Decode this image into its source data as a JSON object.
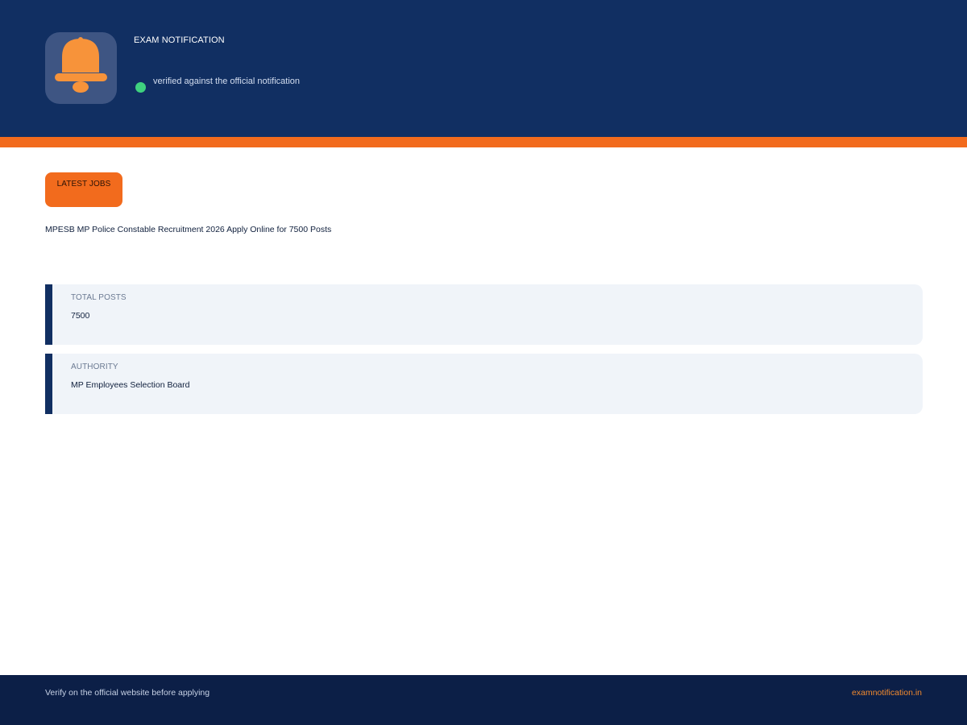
{
  "header": {
    "icon": "bell-icon",
    "brand": "EXAM NOTIFICATION",
    "status_text": "verified against the official notification",
    "colors": {
      "background": "#112f62",
      "icon_tile": "#3e5583",
      "bell": "#f7933a",
      "status_dot": "#3fd27f"
    }
  },
  "accent_color": "#f26b1d",
  "main": {
    "badge": "LATEST JOBS",
    "headline": "MPESB MP Police Constable Recruitment 2026 Apply Online for 7500 Posts",
    "info_cards": [
      {
        "label": "TOTAL POSTS",
        "value": "7500"
      },
      {
        "label": "AUTHORITY",
        "value": "MP Employees Selection Board"
      }
    ]
  },
  "footer": {
    "note": "Verify on the official website before applying",
    "link": "examnotification.in",
    "colors": {
      "background": "#0c1f47",
      "link": "#f28a2e"
    }
  }
}
